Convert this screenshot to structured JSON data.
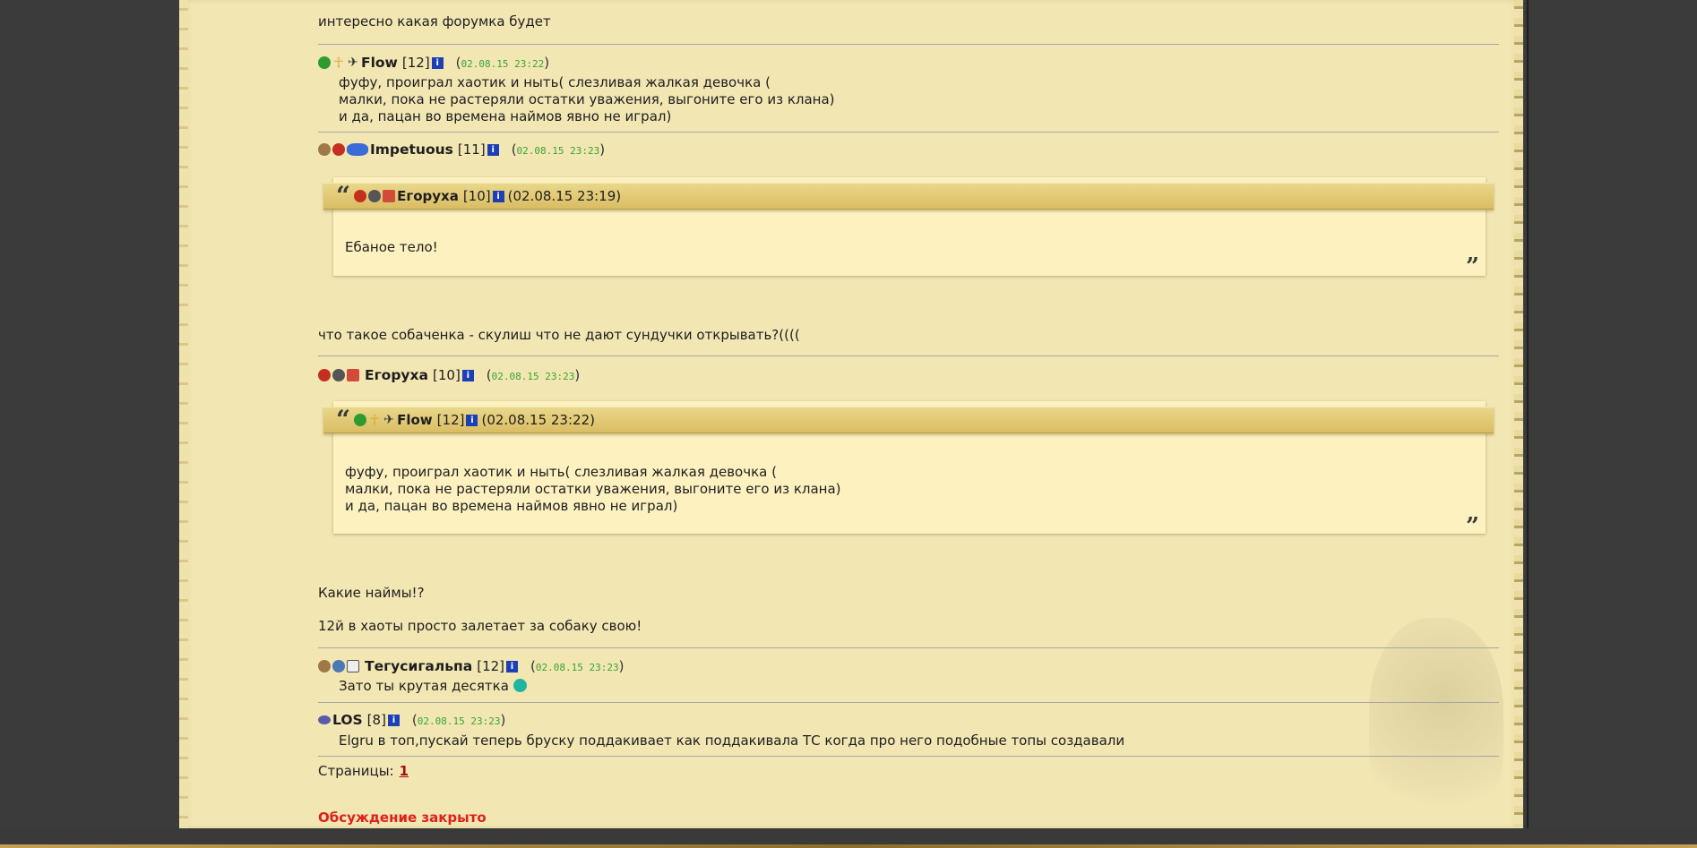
{
  "posts": [
    {
      "text": "интересно какая форумка будет"
    },
    {
      "author": {
        "nick": "Flow",
        "level": "[12]",
        "time": "02.08.15 23:22",
        "icons": [
          "green-orb-icon",
          "ankh-icon",
          "wings-icon"
        ]
      },
      "lines": [
        "фуфу, проиграл хаотик и ныть( слезливая жалкая девочка (",
        "малки, пока не растеряли остатки уважения, выгоните его из клана)",
        "и да, пацан во времена наймов явно не играл)"
      ]
    },
    {
      "author": {
        "nick": "Impetuous",
        "level": "[11]",
        "time": "02.08.15 23:23",
        "icons": [
          "clan-icon",
          "red-orb-icon",
          "blue-flowers-icon"
        ]
      },
      "quote": {
        "nick": "Егоруха",
        "level": "[10]",
        "time": "(02.08.15 23:19)",
        "text": "Ебаное тело!"
      },
      "text": "что такое собаченка - скулиш что не дают сундучки открывать?(((("
    },
    {
      "author": {
        "nick": "Егоруха",
        "level": "[10]",
        "time": "02.08.15 23:23",
        "icons": [
          "crab-icon",
          "skull-icon",
          "red-rune-icon"
        ]
      },
      "quote": {
        "nick": "Flow",
        "level": "[12]",
        "time": "(02.08.15 23:22)",
        "lines": [
          "фуфу, проиграл хаотик и ныть( слезливая жалкая девочка (",
          "малки, пока не растеряли остатки уважения, выгоните его из клана)",
          "и да, пацан во времена наймов явно не играл)"
        ]
      },
      "lines": [
        "Какие наймы!?",
        "12й в хаоты просто залетает за собаку свою!"
      ]
    },
    {
      "author": {
        "nick": "Тегусигальпа",
        "level": "[12]",
        "time": "02.08.15 23:23",
        "icons": [
          "clan-icon",
          "blue-shield-icon",
          "white-shield-icon"
        ]
      },
      "text": "Зато ты крутая десятка",
      "smiley": "smile-icon"
    },
    {
      "author": {
        "nick": "LOS",
        "level": "[8]",
        "time": "02.08.15 23:23",
        "icons": [
          "eye-icon"
        ]
      },
      "text": "Elgru в топ,пускай теперь бруску поддакивает как поддакивала ТС когда про него подобные топы создавали"
    }
  ],
  "pagination": {
    "label": "Страницы:",
    "current": "1"
  },
  "closed_notice": "Обсуждение закрыто",
  "info_glyph": "i",
  "quote_open": "“",
  "quote_close": "”",
  "colors": {
    "parchment": "#f2e6b3",
    "timestamp": "#39a535",
    "closed": "#e0201a",
    "info": "#1c3fb8"
  }
}
